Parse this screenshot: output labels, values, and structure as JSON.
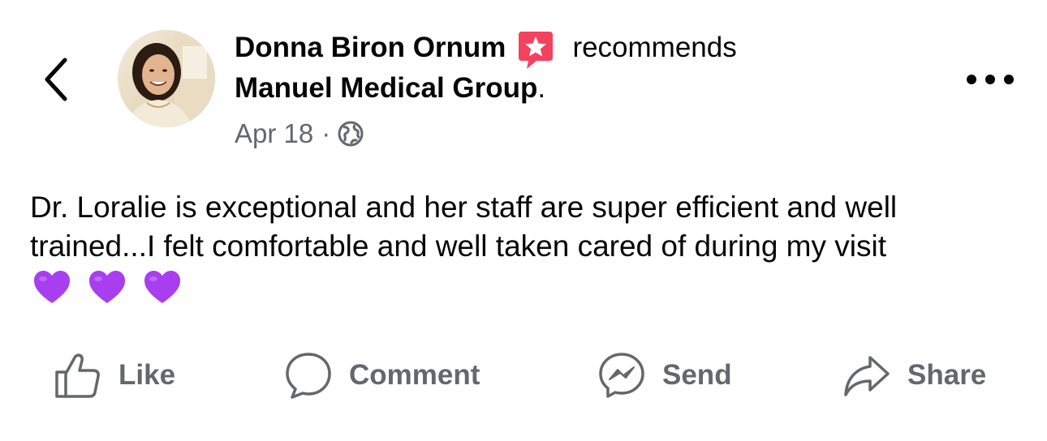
{
  "header": {
    "author_name": "Donna Biron Ornum",
    "action_text": "recommends",
    "page_name": "Manuel Medical Group",
    "page_name_suffix": ".",
    "date": "Apr 18",
    "separator": "·",
    "badge_icon": "recommendation-star-icon",
    "privacy_icon": "globe-icon",
    "back_icon": "chevron-left-icon",
    "more_icon": "more-dots-icon"
  },
  "post": {
    "text": "Dr. Loralie is exceptional and her staff are super efficient and well trained...I felt comfortable and well taken cared of during my visit",
    "emojis": [
      "purple-heart",
      "purple-heart",
      "purple-heart"
    ]
  },
  "actions": {
    "like_label": "Like",
    "comment_label": "Comment",
    "send_label": "Send",
    "share_label": "Share"
  },
  "colors": {
    "primary_text": "#050505",
    "secondary_text": "#65676b",
    "badge": "#f3425f",
    "heart": "#a83ef0"
  }
}
